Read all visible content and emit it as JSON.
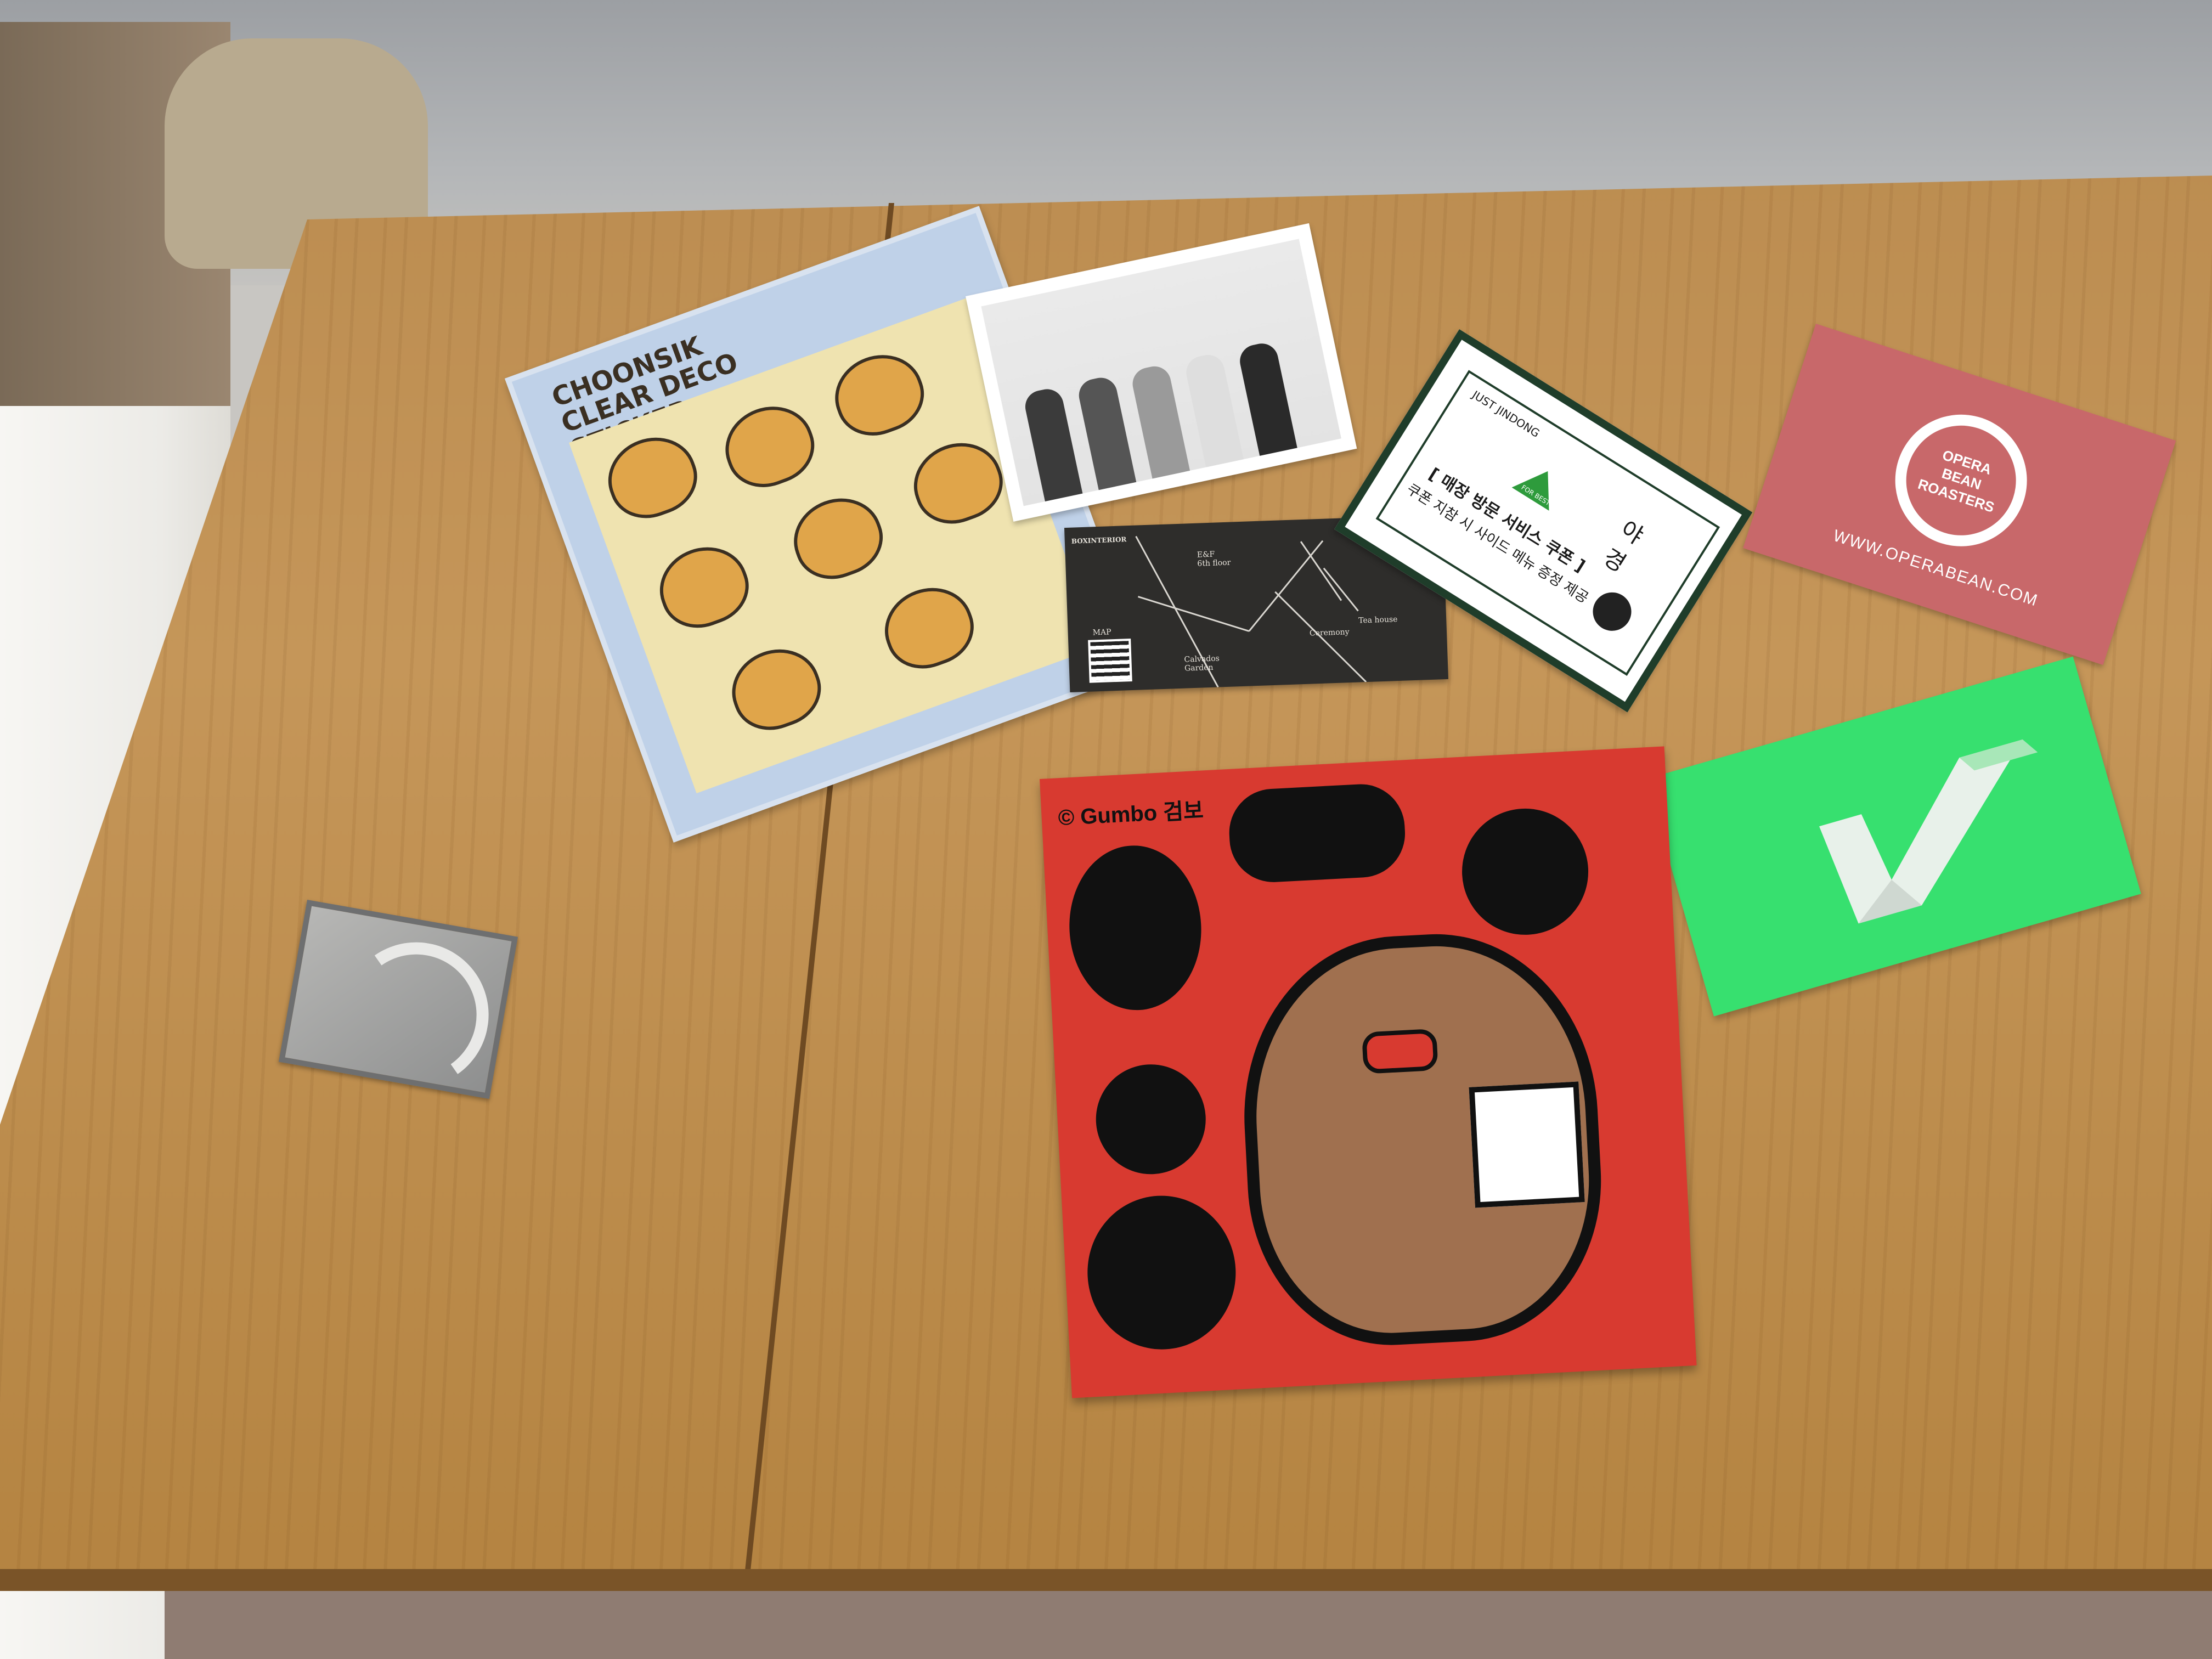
{
  "sticker_sheet": {
    "brand": "CHOONSIK",
    "title_line1": "CLEAR DECO",
    "title_line2": "STICKER"
  },
  "map_card": {
    "title": "BOXINTERIOR",
    "label_map": "MAP",
    "label_floor": "E&F\n6th floor",
    "label_garden": "Calvados\nGarden",
    "label_ceremony": "Ceremony",
    "label_tea": "Tea house"
  },
  "green_card": {
    "brand": "JUST JINDONG",
    "line1": "[ 매장 방문 서비스 쿠폰 ]",
    "line2": "쿠폰 지참 시 사이드 메뉴 증정 제공",
    "word1": "야",
    "word2": "경",
    "badge": "FOR BEST"
  },
  "pink_card": {
    "logo_line1": "OPERA",
    "logo_line2": "BEAN",
    "logo_line3": "ROASTERS",
    "url": "WWW.OPERABEAN.COM"
  },
  "red_sheet": {
    "brand": "Gumbo",
    "brand_korean": "검보"
  }
}
